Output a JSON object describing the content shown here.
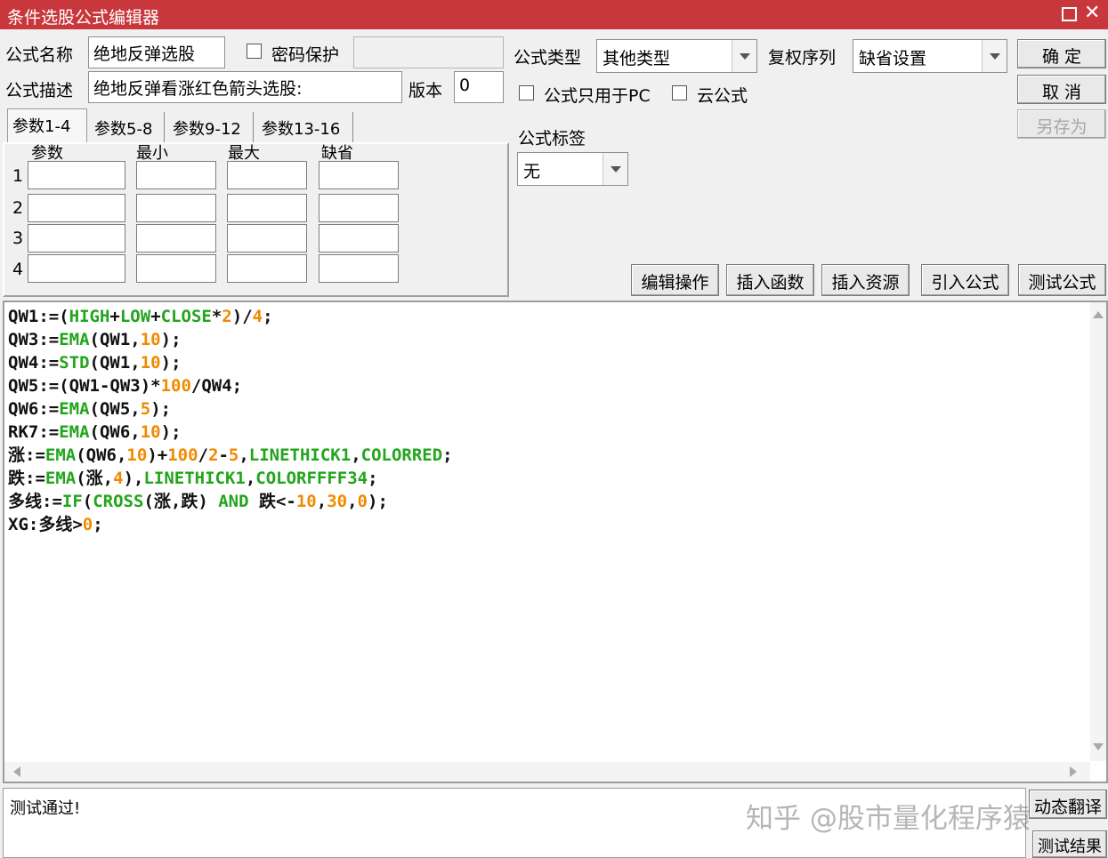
{
  "window": {
    "title": "条件选股公式编辑器"
  },
  "form": {
    "name_label": "公式名称",
    "name_value": "绝地反弹选股",
    "password_label": "密码保护",
    "password_value": "",
    "desc_label": "公式描述",
    "desc_value": "绝地反弹看涨红色箭头选股:",
    "version_label": "版本",
    "version_value": "0",
    "type_label": "公式类型",
    "type_value": "其他类型",
    "fq_label": "复权序列",
    "fq_value": "缺省设置",
    "pc_only_label": "公式只用于PC",
    "cloud_label": "云公式",
    "tag_label": "公式标签",
    "tag_value": "无"
  },
  "buttons": {
    "ok": "确 定",
    "cancel": "取 消",
    "save_as": "另存为",
    "edit_ops": "编辑操作",
    "insert_func": "插入函数",
    "insert_res": "插入资源",
    "import_formula": "引入公式",
    "test_formula": "测试公式",
    "auto_translate": "动态翻译",
    "test_result": "测试结果"
  },
  "params": {
    "tabs": [
      "参数1-4",
      "参数5-8",
      "参数9-12",
      "参数13-16"
    ],
    "headers": [
      "参数",
      "最小",
      "最大",
      "缺省"
    ],
    "rows": [
      "1",
      "2",
      "3",
      "4"
    ]
  },
  "code_colors": {
    "default": "#111111",
    "function": "#22a51c",
    "number": "#f08a00"
  },
  "code": [
    [
      [
        "QW1:=(",
        "d"
      ],
      [
        "HIGH",
        "f"
      ],
      [
        "+",
        "d"
      ],
      [
        "LOW",
        "f"
      ],
      [
        "+",
        "d"
      ],
      [
        "CLOSE",
        "f"
      ],
      [
        "*",
        "d"
      ],
      [
        "2",
        "n"
      ],
      [
        ")/",
        "d"
      ],
      [
        "4",
        "n"
      ],
      [
        ";",
        "d"
      ]
    ],
    [
      [
        "QW3:=",
        "d"
      ],
      [
        "EMA",
        "f"
      ],
      [
        "(QW1,",
        "d"
      ],
      [
        "10",
        "n"
      ],
      [
        ");",
        "d"
      ]
    ],
    [
      [
        "QW4:=",
        "d"
      ],
      [
        "STD",
        "f"
      ],
      [
        "(QW1,",
        "d"
      ],
      [
        "10",
        "n"
      ],
      [
        ");",
        "d"
      ]
    ],
    [
      [
        "QW5:=(QW1-QW3)*",
        "d"
      ],
      [
        "100",
        "n"
      ],
      [
        "/QW4;",
        "d"
      ]
    ],
    [
      [
        "QW6:=",
        "d"
      ],
      [
        "EMA",
        "f"
      ],
      [
        "(QW5,",
        "d"
      ],
      [
        "5",
        "n"
      ],
      [
        ");",
        "d"
      ]
    ],
    [
      [
        "RK7:=",
        "d"
      ],
      [
        "EMA",
        "f"
      ],
      [
        "(QW6,",
        "d"
      ],
      [
        "10",
        "n"
      ],
      [
        ");",
        "d"
      ]
    ],
    [
      [
        "涨:=",
        "d"
      ],
      [
        "EMA",
        "f"
      ],
      [
        "(QW6,",
        "d"
      ],
      [
        "10",
        "n"
      ],
      [
        ")+",
        "d"
      ],
      [
        "100",
        "n"
      ],
      [
        "/",
        "d"
      ],
      [
        "2",
        "n"
      ],
      [
        "-",
        "d"
      ],
      [
        "5",
        "n"
      ],
      [
        ",",
        "d"
      ],
      [
        "LINETHICK1",
        "f"
      ],
      [
        ",",
        "d"
      ],
      [
        "COLORRED",
        "f"
      ],
      [
        ";",
        "d"
      ]
    ],
    [
      [
        "跌:=",
        "d"
      ],
      [
        "EMA",
        "f"
      ],
      [
        "(涨,",
        "d"
      ],
      [
        "4",
        "n"
      ],
      [
        "),",
        "d"
      ],
      [
        "LINETHICK1",
        "f"
      ],
      [
        ",",
        "d"
      ],
      [
        "COLORFFFF34",
        "f"
      ],
      [
        ";",
        "d"
      ]
    ],
    [
      [
        "多线:=",
        "d"
      ],
      [
        "IF",
        "f"
      ],
      [
        "(",
        "d"
      ],
      [
        "CROSS",
        "f"
      ],
      [
        "(涨,跌) ",
        "d"
      ],
      [
        "AND",
        "f"
      ],
      [
        " 跌<-",
        "d"
      ],
      [
        "10",
        "n"
      ],
      [
        ",",
        "d"
      ],
      [
        "30",
        "n"
      ],
      [
        ",",
        "d"
      ],
      [
        "0",
        "n"
      ],
      [
        ");",
        "d"
      ]
    ],
    [
      [
        "XG:多线>",
        "d"
      ],
      [
        "0",
        "n"
      ],
      [
        ";",
        "d"
      ]
    ]
  ],
  "status": {
    "message": "测试通过!"
  },
  "watermark": "知乎 @股市量化程序猿"
}
